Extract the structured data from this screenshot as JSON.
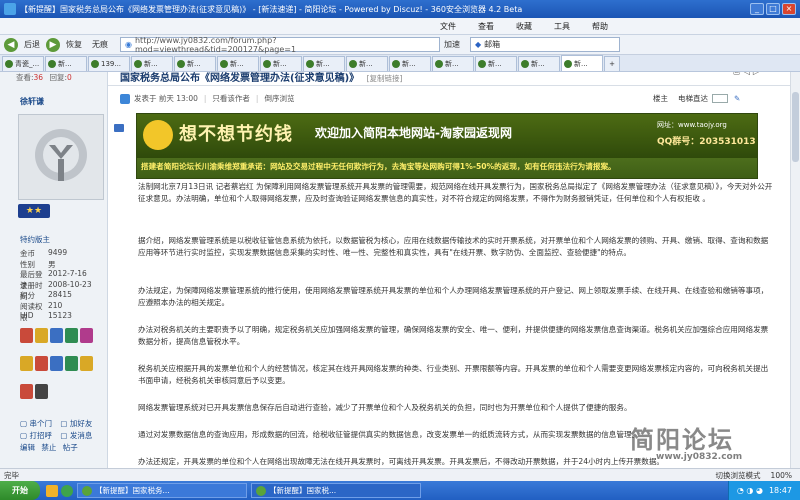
{
  "window": {
    "title": "【新提醒】国家税务总局公布《网络发票管理办法(征求意见稿)》 - [新法速递] - 简阳论坛 - Powered by Discuz! - 360安全浏览器 4.2 Beta"
  },
  "menu": [
    "文件",
    "查看",
    "收藏",
    "工具",
    "帮助"
  ],
  "nav": {
    "back": "后退",
    "restore": "恢复",
    "no_image": "无痕",
    "address": "http://www.jy0832.com/forum.php?mod=viewthread&tid=200127&page=1",
    "accelerate": "加速",
    "search_placeholder": "邮箱"
  },
  "tabs": [
    "青瓷_...",
    "新...",
    "139...",
    "新...",
    "新...",
    "新...",
    "新...",
    "新...",
    "新...",
    "新...",
    "新...",
    "新...",
    "新...",
    "新..."
  ],
  "sidebar": {
    "views_label": "查看:",
    "views": "36",
    "replies_label": "回复:",
    "replies": "0",
    "username": "徐轩谦",
    "rank": "特约版主",
    "stats": [
      {
        "k": "金币",
        "v": "9499"
      },
      {
        "k": "性别",
        "v": "男"
      },
      {
        "k": "最后登录",
        "v": "2012-7-16"
      },
      {
        "k": "注册时间",
        "v": "2008-10-23"
      },
      {
        "k": "积分",
        "v": "28415"
      },
      {
        "k": "阅读权限",
        "v": "210"
      },
      {
        "k": "UID",
        "v": "15123"
      }
    ],
    "actions": [
      "串个门",
      "加好友",
      "打招呼",
      "发消息"
    ],
    "actions2": [
      "编辑",
      "禁止",
      "帖子"
    ]
  },
  "post": {
    "title": "国家税务总局公布《网络发票管理办法(征求意见稿)》",
    "copy_link": "[复制链接]",
    "meta": "发表于 前天 13:00",
    "only_author": "只看该作者",
    "reverse": "倒序浏览",
    "floor": "楼主",
    "goto": "电梯直达",
    "banner_title": "想不想节约钱",
    "banner_sub": "欢迎加入简阳本地网站-淘家园返现网",
    "banner_url_label": "网址：www.taojy.org",
    "banner_qq": "QQ群号：203531013",
    "banner_foot": "搭建者简阳论坛长川渝乘维郑重承诺：网站及交易过程中无任何欺诈行为，去淘宝等处网购可得1%-50%的返现，如有任何违法行为请报案。",
    "paragraphs": [
      "法制网北京7月13日讯 记者蔡岩红 为保障利用网络发票管理系统开具发票的管理需要，规范网络在线开具发票行为，国家税务总局拟定了《网络发票管理办法（征求意见稿）》，今天对外公开征求意见。办法明确，单位和个人取得网络发票，应及时查询验证网络发票信息的真实性，对不符合规定的网络发票，不得作为财务报销凭证，任何单位和个人有权拒收 。",
      "据介绍，网络发票管理系统是以税收征管信息系统为依托，以数据管税为核心，应用在线数据传输技术的实时开票系统，对开票单位和个人网络发票的领购、开具、缴销、取得、查询和数据应用等环节进行实时监控，实现发票数据信息采集的实时性、唯一性、完整性和真实性，具有\"在线开票、数字防伪、全面监控、查验便捷\"的特点。",
      "办法规定，为保障网络发票管理系统的推行使用，使用网络发票管理系统开具发票的单位和个人办理网络发票管理系统的开户登记、网上领取发票手续、在线开具、在线查验和缴销等事项，应遵照本办法的相关规定。",
      "办法对税务机关的主要职责予以了明确，规定税务机关应加强网络发票的管理，确保网络发票的安全、唯一、便利，并提供便捷的网络发票信息查询渠道。税务机关应加强综合应用网络发票数据分析，提高信息管税水平。",
      "税务机关应根据开具的发票单位和个人的经营情况，核定其在线开具网络发票的种类、行业类别、开票限额等内容。开具发票的单位和个人需要变更网络发票核定内容的，可向税务机关提出书面申请，经税务机关审核同意后予以变更。",
      "网络发票管理系统对已开具发票信息保存后自动进行查验，减少了开票单位和个人及税务机关的负担，同时也为开票单位和个人提供了便捷的服务。",
      "通过对发票数据信息的查询应用，形成数据的回流，给税收征管提供真实的数据信息，改变发票单一的纸质流转方式，从而实现发票数据的信息管理。",
      "办法还规定，开具发票的单位和个人在网络出现故障无法在线开具发票时，可离线开具发票。开具发票后，不得改动开票数据，并于24小时内上传开票数据。"
    ]
  },
  "watermark": "简阳论坛",
  "watermark_url": "www.jy0832.com",
  "status": {
    "text": "完毕",
    "zoom": "100%",
    "mode": "切换浏览模式"
  },
  "taskbar": {
    "start": "开始",
    "task1": "【新提醒】国家税务...",
    "task2": "【新提醒】国家税...",
    "time": "18:47"
  }
}
